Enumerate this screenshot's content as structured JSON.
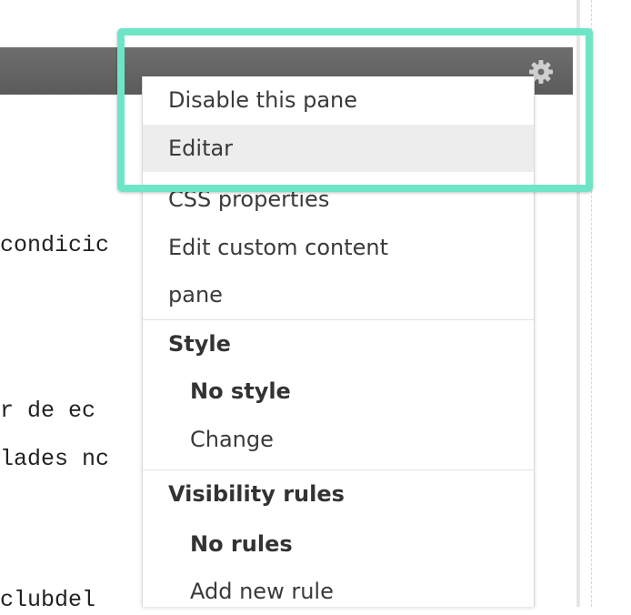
{
  "background_lines": [
    "condicic",
    "r de ec",
    "lades nc",
    "clubdel"
  ],
  "menu": {
    "items": [
      {
        "label": "Disable this pane"
      },
      {
        "label": "Editar"
      },
      {
        "label": "CSS properties"
      },
      {
        "label": "Edit custom content"
      },
      {
        "label": "pane"
      }
    ],
    "style_section": {
      "heading": "Style",
      "current": "No style",
      "action": "Change"
    },
    "visibility_section": {
      "heading": "Visibility rules",
      "current": "No rules",
      "action": "Add new rule"
    }
  },
  "colors": {
    "highlight": "#6ee5c6",
    "header": "#666666"
  },
  "icons": {
    "settings": "gear-icon"
  }
}
